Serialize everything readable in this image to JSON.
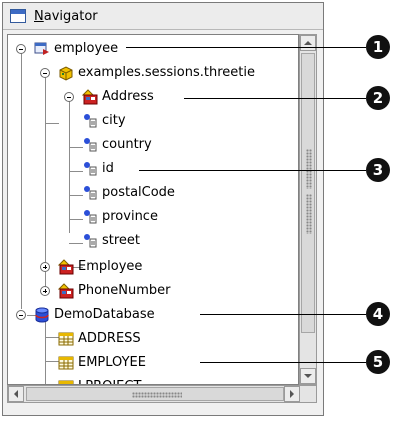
{
  "panel": {
    "title": "Navigator",
    "title_mnemonic": "N",
    "title_rest": "avigator"
  },
  "tree": {
    "root": {
      "label": "employee",
      "icon": "project-icon",
      "expanded": true
    },
    "session": {
      "label": "examples.sessions.threetie",
      "icon": "package-icon",
      "expanded": true
    },
    "address": {
      "label": "Address",
      "icon": "descriptor-icon",
      "expanded": true
    },
    "address_fields": [
      "city",
      "country",
      "id",
      "postalCode",
      "province",
      "street"
    ],
    "employee": {
      "label": "Employee",
      "icon": "descriptor-icon",
      "expanded": false
    },
    "phone": {
      "label": "PhoneNumber",
      "icon": "descriptor-icon",
      "expanded": false
    },
    "database": {
      "label": "DemoDatabase",
      "icon": "database-icon",
      "expanded": true
    },
    "tables": [
      "ADDRESS",
      "EMPLOYEE",
      "LPROJECT"
    ]
  },
  "callouts": [
    "1",
    "2",
    "3",
    "4",
    "5"
  ],
  "colors": {
    "callout": "#111111",
    "selection_accent": "#3d6bc4",
    "db_icon": "#2b4fd8",
    "descriptor_red": "#cc2222",
    "descriptor_yellow": "#f2c200"
  }
}
